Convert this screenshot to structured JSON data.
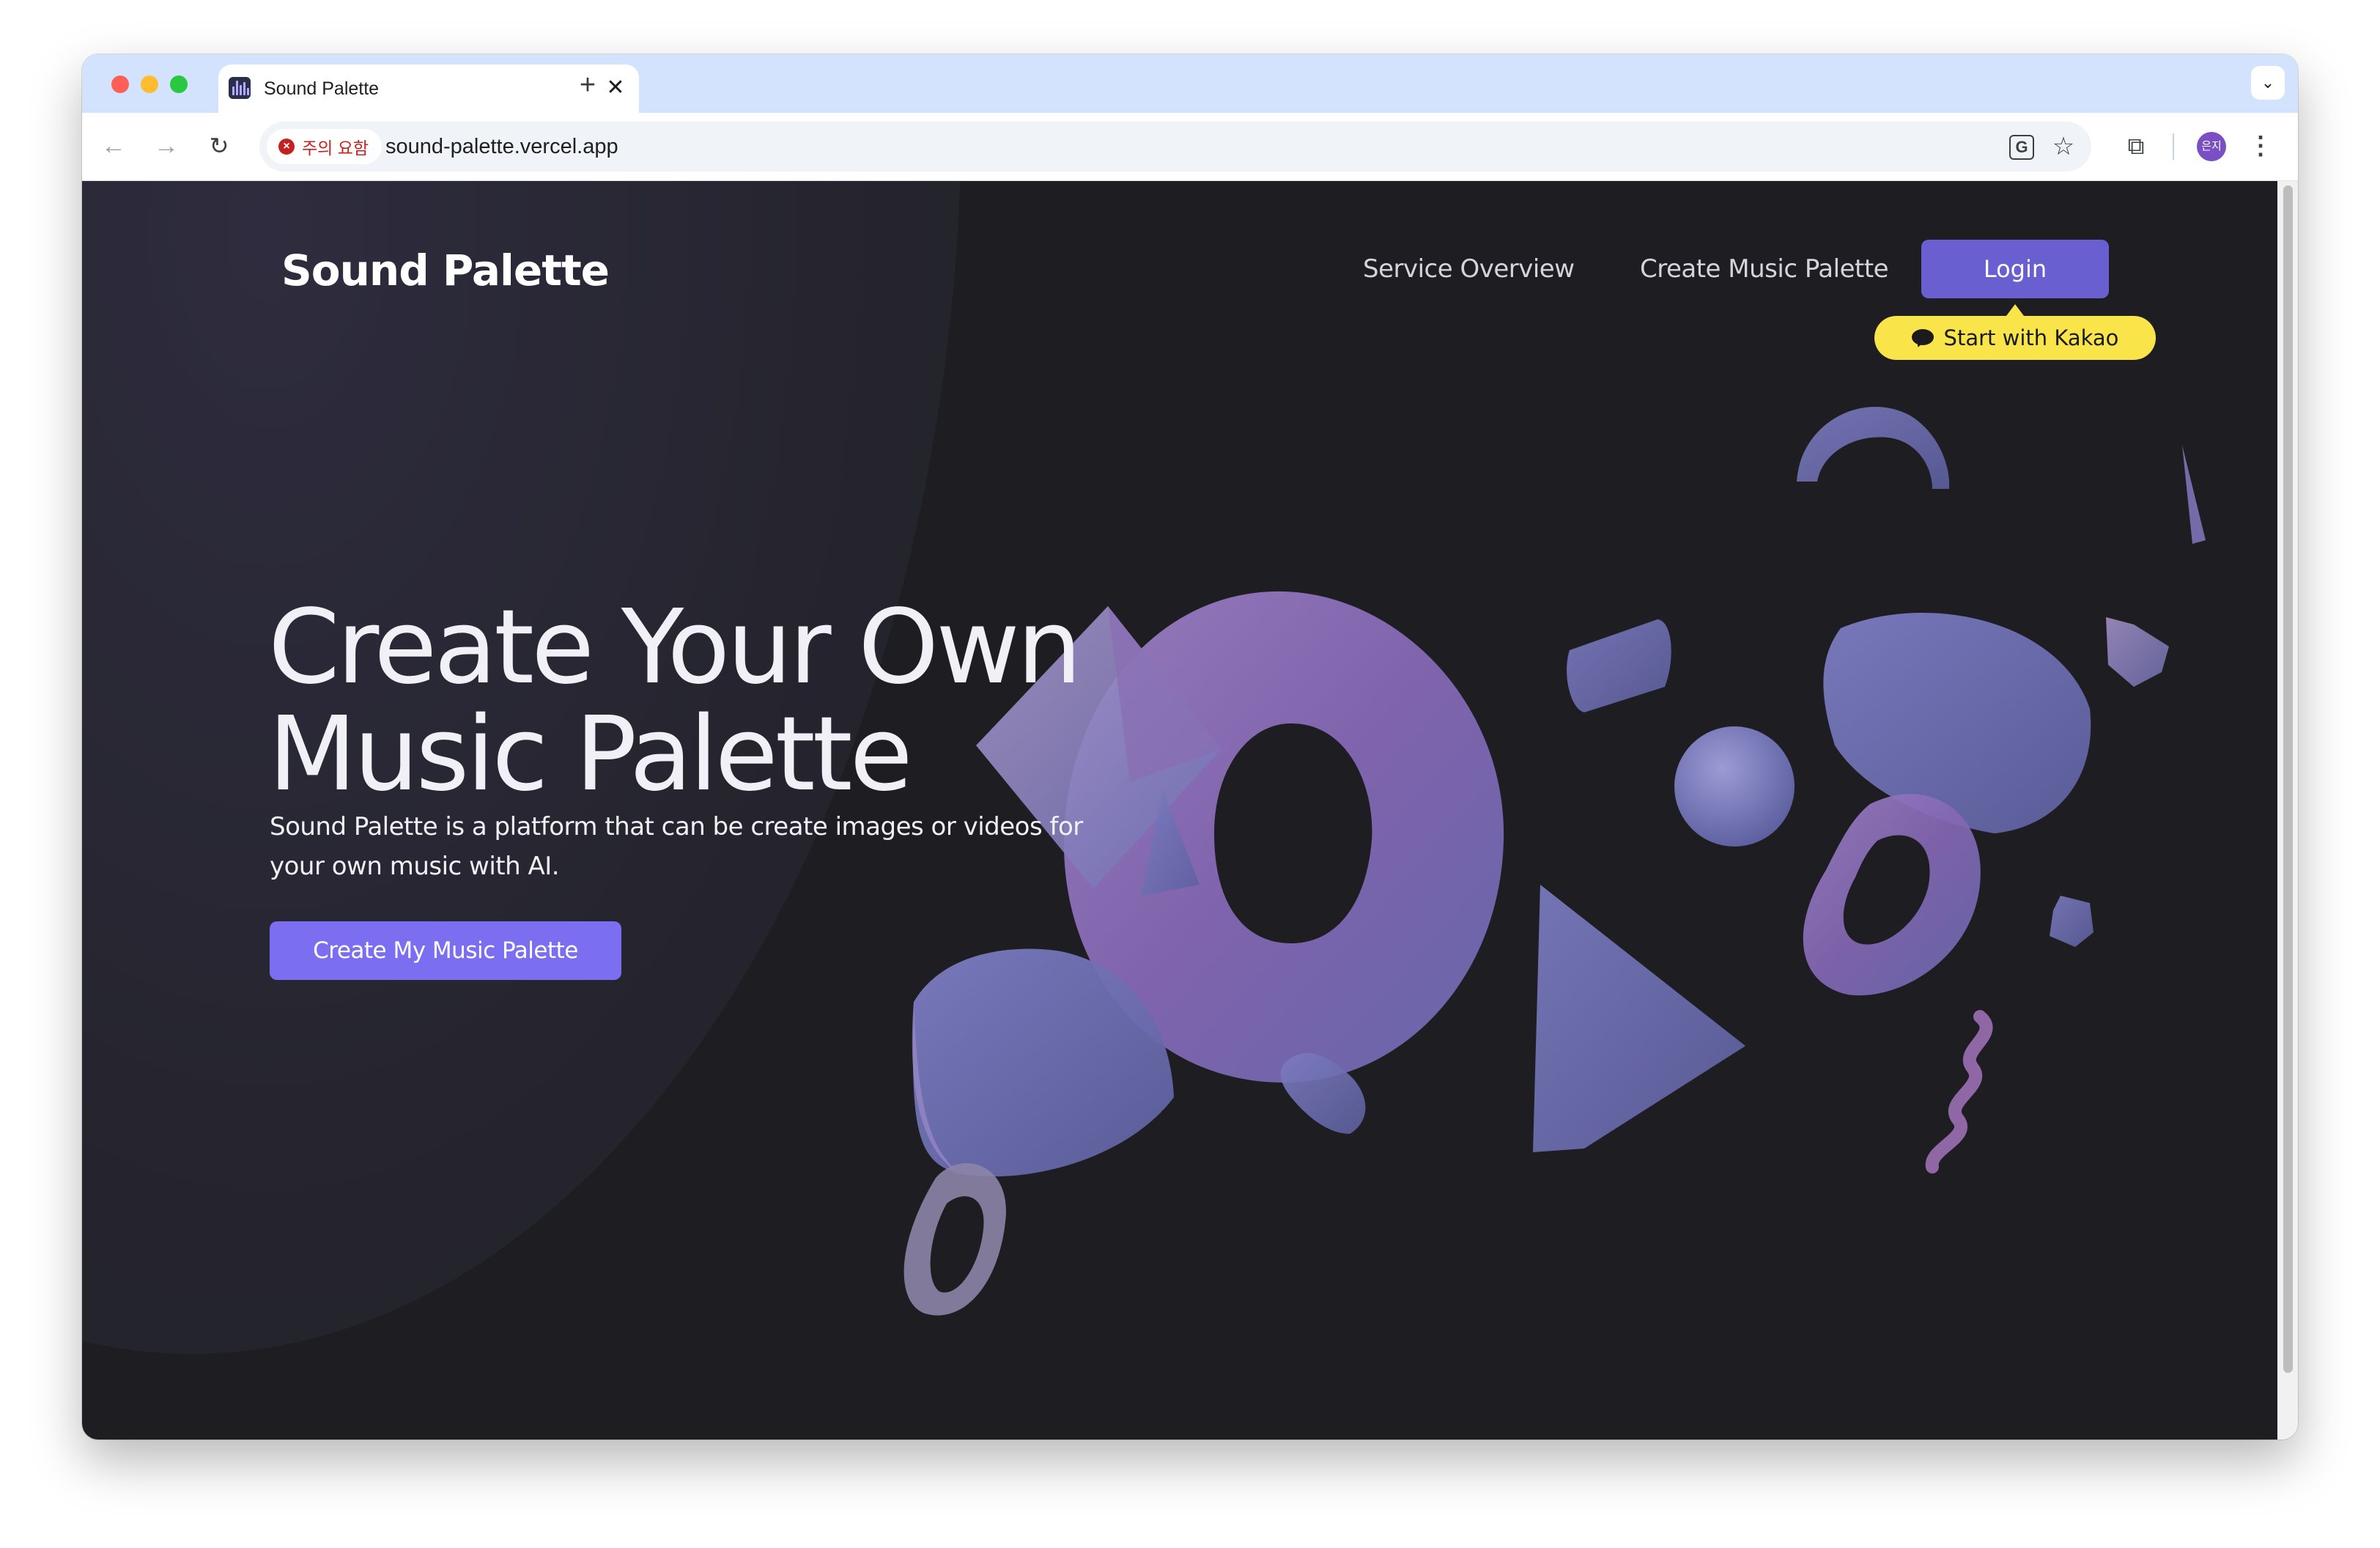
{
  "browser": {
    "tab_title": "Sound Palette",
    "tab_close_glyph": "✕",
    "new_tab_glyph": "+",
    "tab_search_glyph": "⌄",
    "security_label": "주의 요함",
    "url": "sound-palette.vercel.app",
    "avatar_text": "은지",
    "icons": [
      "back-icon",
      "forward-icon",
      "reload-icon",
      "translate-icon",
      "star-icon",
      "extensions-icon",
      "menu-icon"
    ]
  },
  "site": {
    "logo": "Sound Palette",
    "nav": {
      "overview": "Service Overview",
      "create": "Create Music Palette",
      "login": "Login",
      "kakao": "Start with Kakao"
    },
    "hero": {
      "title": "Create Your Own\nMusic Palette",
      "description": "Sound Palette is a platform that can be create images or videos for your own music with AI.",
      "cta": "Create My Music Palette"
    }
  },
  "colors": {
    "page_bg": "#1e1e22",
    "accent": "#7b6ef0",
    "login_bg": "#6a5fd0",
    "kakao": "#f9e44a",
    "shape_purple": "#8a72b8",
    "shape_blue": "#6e73b5"
  }
}
